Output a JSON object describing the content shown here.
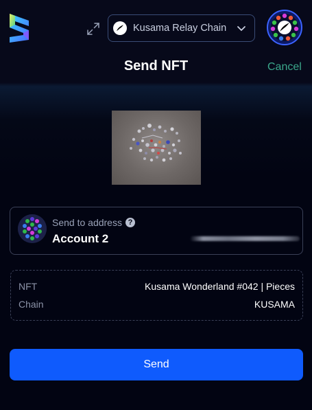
{
  "header": {
    "network_label": "Kusama Relay Chain",
    "network_icon": "kusama-icon",
    "expand_icon": "expand-icon",
    "dropdown_icon": "chevron-down-icon"
  },
  "page": {
    "title": "Send NFT",
    "cancel_label": "Cancel"
  },
  "recipient": {
    "label": "Send to address",
    "help_icon": "?",
    "account_name": "Account 2"
  },
  "details": {
    "rows": [
      {
        "key": "NFT",
        "value": "Kusama Wonderland #042 | Pieces"
      },
      {
        "key": "Chain",
        "value": "KUSAMA"
      }
    ]
  },
  "actions": {
    "send_label": "Send"
  },
  "colors": {
    "background": "#020412",
    "accent": "#0f5bfd",
    "cancel": "#3ba88c",
    "border": "#3b4158"
  }
}
